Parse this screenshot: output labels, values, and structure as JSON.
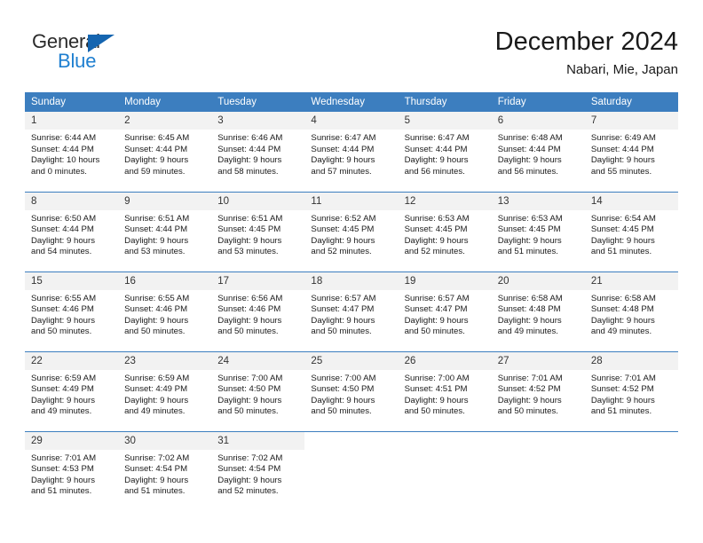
{
  "logo": {
    "word_one": "General",
    "word_two": "Blue",
    "triangle_icon": "triangle-icon",
    "accent_dark": "#1565b0",
    "accent_light": "#1f7fd0"
  },
  "header": {
    "title": "December 2024",
    "subtitle": "Nabari, Mie, Japan"
  },
  "calendar": {
    "header_bg": "#3c7ebf",
    "daynum_bg": "#f2f2f2",
    "weekdays": [
      "Sunday",
      "Monday",
      "Tuesday",
      "Wednesday",
      "Thursday",
      "Friday",
      "Saturday"
    ],
    "weeks": [
      [
        {
          "day": "1",
          "sunrise": "Sunrise: 6:44 AM",
          "sunset": "Sunset: 4:44 PM",
          "daylight_1": "Daylight: 10 hours",
          "daylight_2": "and 0 minutes."
        },
        {
          "day": "2",
          "sunrise": "Sunrise: 6:45 AM",
          "sunset": "Sunset: 4:44 PM",
          "daylight_1": "Daylight: 9 hours",
          "daylight_2": "and 59 minutes."
        },
        {
          "day": "3",
          "sunrise": "Sunrise: 6:46 AM",
          "sunset": "Sunset: 4:44 PM",
          "daylight_1": "Daylight: 9 hours",
          "daylight_2": "and 58 minutes."
        },
        {
          "day": "4",
          "sunrise": "Sunrise: 6:47 AM",
          "sunset": "Sunset: 4:44 PM",
          "daylight_1": "Daylight: 9 hours",
          "daylight_2": "and 57 minutes."
        },
        {
          "day": "5",
          "sunrise": "Sunrise: 6:47 AM",
          "sunset": "Sunset: 4:44 PM",
          "daylight_1": "Daylight: 9 hours",
          "daylight_2": "and 56 minutes."
        },
        {
          "day": "6",
          "sunrise": "Sunrise: 6:48 AM",
          "sunset": "Sunset: 4:44 PM",
          "daylight_1": "Daylight: 9 hours",
          "daylight_2": "and 56 minutes."
        },
        {
          "day": "7",
          "sunrise": "Sunrise: 6:49 AM",
          "sunset": "Sunset: 4:44 PM",
          "daylight_1": "Daylight: 9 hours",
          "daylight_2": "and 55 minutes."
        }
      ],
      [
        {
          "day": "8",
          "sunrise": "Sunrise: 6:50 AM",
          "sunset": "Sunset: 4:44 PM",
          "daylight_1": "Daylight: 9 hours",
          "daylight_2": "and 54 minutes."
        },
        {
          "day": "9",
          "sunrise": "Sunrise: 6:51 AM",
          "sunset": "Sunset: 4:44 PM",
          "daylight_1": "Daylight: 9 hours",
          "daylight_2": "and 53 minutes."
        },
        {
          "day": "10",
          "sunrise": "Sunrise: 6:51 AM",
          "sunset": "Sunset: 4:45 PM",
          "daylight_1": "Daylight: 9 hours",
          "daylight_2": "and 53 minutes."
        },
        {
          "day": "11",
          "sunrise": "Sunrise: 6:52 AM",
          "sunset": "Sunset: 4:45 PM",
          "daylight_1": "Daylight: 9 hours",
          "daylight_2": "and 52 minutes."
        },
        {
          "day": "12",
          "sunrise": "Sunrise: 6:53 AM",
          "sunset": "Sunset: 4:45 PM",
          "daylight_1": "Daylight: 9 hours",
          "daylight_2": "and 52 minutes."
        },
        {
          "day": "13",
          "sunrise": "Sunrise: 6:53 AM",
          "sunset": "Sunset: 4:45 PM",
          "daylight_1": "Daylight: 9 hours",
          "daylight_2": "and 51 minutes."
        },
        {
          "day": "14",
          "sunrise": "Sunrise: 6:54 AM",
          "sunset": "Sunset: 4:45 PM",
          "daylight_1": "Daylight: 9 hours",
          "daylight_2": "and 51 minutes."
        }
      ],
      [
        {
          "day": "15",
          "sunrise": "Sunrise: 6:55 AM",
          "sunset": "Sunset: 4:46 PM",
          "daylight_1": "Daylight: 9 hours",
          "daylight_2": "and 50 minutes."
        },
        {
          "day": "16",
          "sunrise": "Sunrise: 6:55 AM",
          "sunset": "Sunset: 4:46 PM",
          "daylight_1": "Daylight: 9 hours",
          "daylight_2": "and 50 minutes."
        },
        {
          "day": "17",
          "sunrise": "Sunrise: 6:56 AM",
          "sunset": "Sunset: 4:46 PM",
          "daylight_1": "Daylight: 9 hours",
          "daylight_2": "and 50 minutes."
        },
        {
          "day": "18",
          "sunrise": "Sunrise: 6:57 AM",
          "sunset": "Sunset: 4:47 PM",
          "daylight_1": "Daylight: 9 hours",
          "daylight_2": "and 50 minutes."
        },
        {
          "day": "19",
          "sunrise": "Sunrise: 6:57 AM",
          "sunset": "Sunset: 4:47 PM",
          "daylight_1": "Daylight: 9 hours",
          "daylight_2": "and 50 minutes."
        },
        {
          "day": "20",
          "sunrise": "Sunrise: 6:58 AM",
          "sunset": "Sunset: 4:48 PM",
          "daylight_1": "Daylight: 9 hours",
          "daylight_2": "and 49 minutes."
        },
        {
          "day": "21",
          "sunrise": "Sunrise: 6:58 AM",
          "sunset": "Sunset: 4:48 PM",
          "daylight_1": "Daylight: 9 hours",
          "daylight_2": "and 49 minutes."
        }
      ],
      [
        {
          "day": "22",
          "sunrise": "Sunrise: 6:59 AM",
          "sunset": "Sunset: 4:49 PM",
          "daylight_1": "Daylight: 9 hours",
          "daylight_2": "and 49 minutes."
        },
        {
          "day": "23",
          "sunrise": "Sunrise: 6:59 AM",
          "sunset": "Sunset: 4:49 PM",
          "daylight_1": "Daylight: 9 hours",
          "daylight_2": "and 49 minutes."
        },
        {
          "day": "24",
          "sunrise": "Sunrise: 7:00 AM",
          "sunset": "Sunset: 4:50 PM",
          "daylight_1": "Daylight: 9 hours",
          "daylight_2": "and 50 minutes."
        },
        {
          "day": "25",
          "sunrise": "Sunrise: 7:00 AM",
          "sunset": "Sunset: 4:50 PM",
          "daylight_1": "Daylight: 9 hours",
          "daylight_2": "and 50 minutes."
        },
        {
          "day": "26",
          "sunrise": "Sunrise: 7:00 AM",
          "sunset": "Sunset: 4:51 PM",
          "daylight_1": "Daylight: 9 hours",
          "daylight_2": "and 50 minutes."
        },
        {
          "day": "27",
          "sunrise": "Sunrise: 7:01 AM",
          "sunset": "Sunset: 4:52 PM",
          "daylight_1": "Daylight: 9 hours",
          "daylight_2": "and 50 minutes."
        },
        {
          "day": "28",
          "sunrise": "Sunrise: 7:01 AM",
          "sunset": "Sunset: 4:52 PM",
          "daylight_1": "Daylight: 9 hours",
          "daylight_2": "and 51 minutes."
        }
      ],
      [
        {
          "day": "29",
          "sunrise": "Sunrise: 7:01 AM",
          "sunset": "Sunset: 4:53 PM",
          "daylight_1": "Daylight: 9 hours",
          "daylight_2": "and 51 minutes."
        },
        {
          "day": "30",
          "sunrise": "Sunrise: 7:02 AM",
          "sunset": "Sunset: 4:54 PM",
          "daylight_1": "Daylight: 9 hours",
          "daylight_2": "and 51 minutes."
        },
        {
          "day": "31",
          "sunrise": "Sunrise: 7:02 AM",
          "sunset": "Sunset: 4:54 PM",
          "daylight_1": "Daylight: 9 hours",
          "daylight_2": "and 52 minutes."
        },
        {
          "day": "",
          "sunrise": "",
          "sunset": "",
          "daylight_1": "",
          "daylight_2": ""
        },
        {
          "day": "",
          "sunrise": "",
          "sunset": "",
          "daylight_1": "",
          "daylight_2": ""
        },
        {
          "day": "",
          "sunrise": "",
          "sunset": "",
          "daylight_1": "",
          "daylight_2": ""
        },
        {
          "day": "",
          "sunrise": "",
          "sunset": "",
          "daylight_1": "",
          "daylight_2": ""
        }
      ]
    ]
  }
}
